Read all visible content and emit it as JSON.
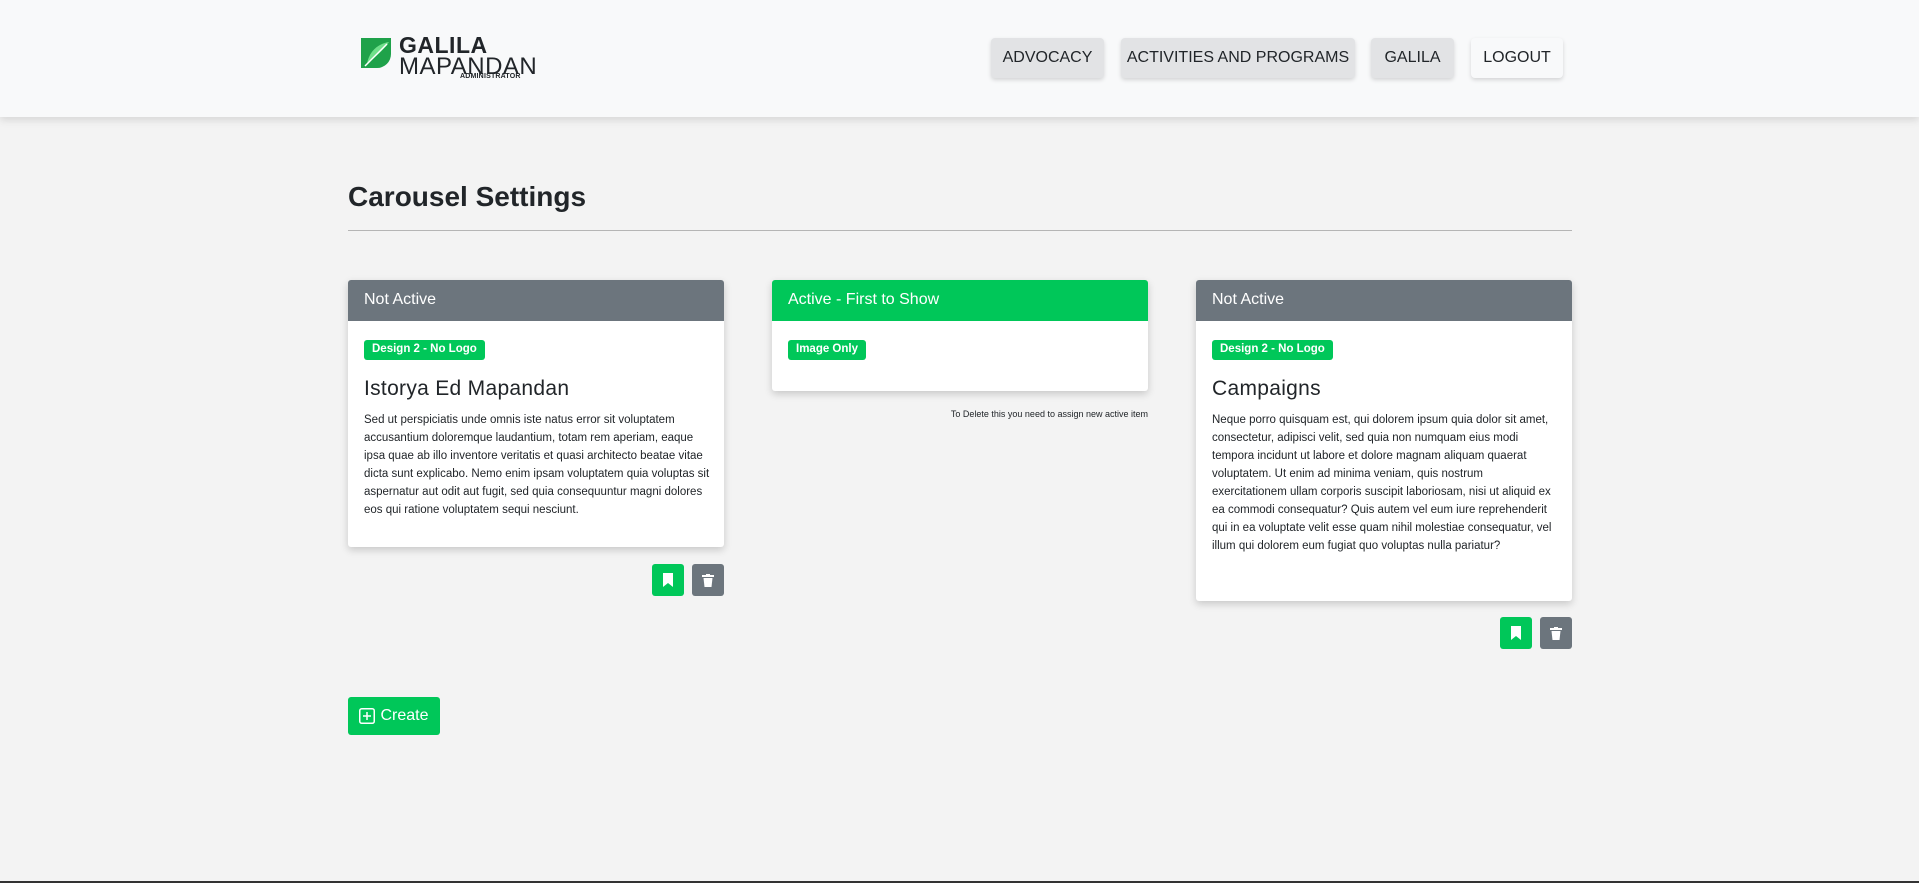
{
  "header": {
    "logo": {
      "line1": "GALILA",
      "line2": "MAPANDAN",
      "line3": "ADMINISTRATOR"
    },
    "nav": [
      {
        "label": "ADVOCACY"
      },
      {
        "label": "ACTIVITIES AND PROGRAMS"
      },
      {
        "label": "GALILA"
      },
      {
        "label": "LOGOUT"
      }
    ]
  },
  "page": {
    "title": "Carousel Settings"
  },
  "cards": [
    {
      "status": "Not Active",
      "badge": "Design 2 - No Logo",
      "title": "Istorya Ed Mapandan",
      "text": "Sed ut perspiciatis unde omnis iste natus error sit voluptatem accusantium doloremque laudantium, totam rem aperiam, eaque ipsa quae ab illo inventore veritatis et quasi architecto beatae vitae dicta sunt explicabo. Nemo enim ipsam voluptatem quia voluptas sit aspernatur aut odit aut fugit, sed quia consequuntur magni dolores eos qui ratione voluptatem sequi nesciunt."
    },
    {
      "status": "Active - First to Show",
      "badge": "Image Only",
      "note": "To Delete this you need to assign new active item"
    },
    {
      "status": "Not Active",
      "badge": "Design 2 - No Logo",
      "title": "Campaigns",
      "text": "Neque porro quisquam est, qui dolorem ipsum quia dolor sit amet, consectetur, adipisci velit, sed quia non numquam eius modi tempora incidunt ut labore et dolore magnam aliquam quaerat voluptatem. Ut enim ad minima veniam, quis nostrum exercitationem ullam corporis suscipit laboriosam, nisi ut aliquid ex ea commodi consequatur? Quis autem vel eum iure reprehenderit qui in ea voluptate velit esse quam nihil molestiae consequatur, vel illum qui dolorem eum fugiat quo voluptas nulla pariatur?"
    }
  ],
  "actions": {
    "create_label": "Create"
  },
  "icons": {
    "logo": "leaf-icon",
    "set_active": "bookmark-icon",
    "delete": "trash-icon",
    "create": "plus-square-icon"
  },
  "colors": {
    "accent": "#00c759",
    "inactive_header": "#6c757d",
    "nav_button": "#e2e3e5",
    "page_bg": "#f3f3f3"
  }
}
